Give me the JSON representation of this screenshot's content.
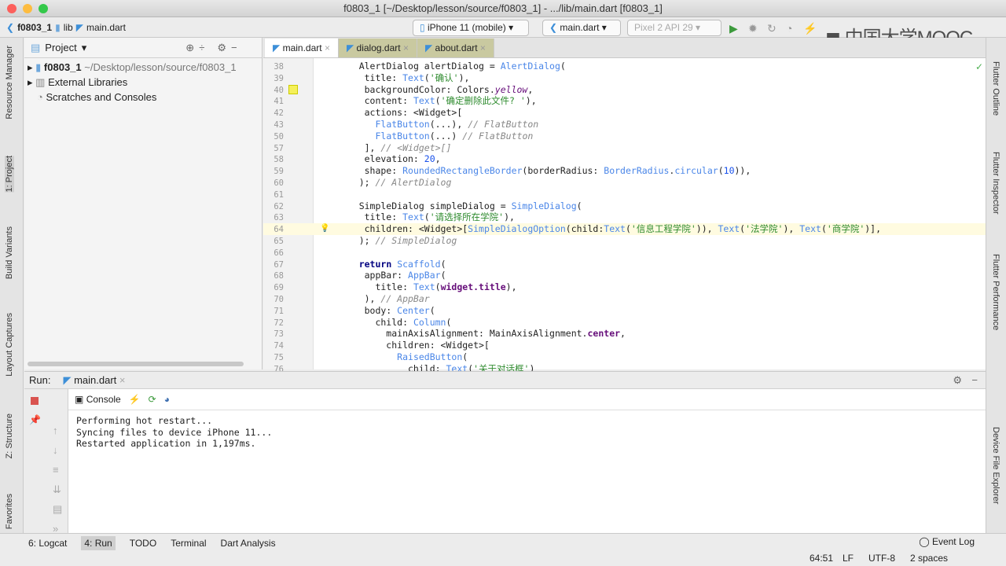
{
  "window": {
    "title": "f0803_1 [~/Desktop/lesson/source/f0803_1] - .../lib/main.dart [f0803_1]"
  },
  "nav": {
    "crumbs": [
      "f0803_1",
      "lib",
      "main.dart"
    ],
    "device": "iPhone 11 (mobile)",
    "config": "main.dart",
    "emulator": "Pixel 2 API 29",
    "watermark": "中国大学MOOC"
  },
  "left_tabs": [
    "Resource Manager",
    "1: Project",
    "Build Variants",
    "Layout Captures",
    "Z: Structure",
    "Favorites"
  ],
  "right_tabs": [
    "Flutter Outline",
    "Flutter Inspector",
    "Flutter Performance",
    "Device File Explorer"
  ],
  "project": {
    "header": "Project",
    "items": [
      {
        "name": "f0803_1",
        "path": "~/Desktop/lesson/source/f0803_1"
      },
      {
        "name": "External Libraries"
      },
      {
        "name": "Scratches and Consoles"
      }
    ]
  },
  "editor": {
    "tabs": [
      "main.dart",
      "dialog.dart",
      "about.dart"
    ],
    "lines": [
      {
        "n": "38",
        "t": [
          [
            "    ",
            ""
          ],
          [
            "AlertDialog alertDialog = ",
            ""
          ],
          [
            "AlertDialog",
            "cl"
          ],
          [
            "(",
            ""
          ]
        ]
      },
      {
        "n": "39",
        "t": [
          [
            "     title: ",
            ""
          ],
          [
            "Text",
            "cl"
          ],
          [
            "(",
            ""
          ],
          [
            "'确认'",
            "st"
          ],
          [
            "),",
            ""
          ]
        ]
      },
      {
        "n": "40",
        "t": [
          [
            "     backgroundColor: Colors.",
            ""
          ],
          [
            "yellow",
            "it"
          ],
          [
            ",",
            ""
          ]
        ]
      },
      {
        "n": "41",
        "t": [
          [
            "     content: ",
            ""
          ],
          [
            "Text",
            "cl"
          ],
          [
            "(",
            ""
          ],
          [
            "'确定删除此文件? '",
            "st"
          ],
          [
            "),",
            ""
          ]
        ]
      },
      {
        "n": "42",
        "t": [
          [
            "     actions: <Widget>[",
            ""
          ]
        ]
      },
      {
        "n": "43",
        "t": [
          [
            "       ",
            ""
          ],
          [
            "FlatButton",
            "cl"
          ],
          [
            "(...)",
            ""
          ],
          [
            ", ",
            ""
          ],
          [
            "// FlatButton",
            "cm"
          ]
        ]
      },
      {
        "n": "50",
        "t": [
          [
            "       ",
            ""
          ],
          [
            "FlatButton",
            "cl"
          ],
          [
            "(...)",
            ""
          ],
          [
            " ",
            ""
          ],
          [
            "// FlatButton",
            "cm"
          ]
        ]
      },
      {
        "n": "57",
        "t": [
          [
            "     ], ",
            ""
          ],
          [
            "// <Widget>[]",
            "cm"
          ]
        ]
      },
      {
        "n": "58",
        "t": [
          [
            "     elevation: ",
            ""
          ],
          [
            "20",
            "nu"
          ],
          [
            ",",
            ""
          ]
        ]
      },
      {
        "n": "59",
        "t": [
          [
            "     shape: ",
            ""
          ],
          [
            "RoundedRectangleBorder",
            "cl"
          ],
          [
            "(borderRadius: ",
            ""
          ],
          [
            "BorderRadius",
            "cl"
          ],
          [
            ".",
            ""
          ],
          [
            "circular",
            "cl"
          ],
          [
            "(",
            ""
          ],
          [
            "10",
            "nu"
          ],
          [
            ")),",
            ""
          ]
        ]
      },
      {
        "n": "60",
        "t": [
          [
            "    ); ",
            ""
          ],
          [
            "// AlertDialog",
            "cm"
          ]
        ]
      },
      {
        "n": "61",
        "t": []
      },
      {
        "n": "62",
        "t": [
          [
            "    SimpleDialog simpleDialog = ",
            ""
          ],
          [
            "SimpleDialog",
            "cl"
          ],
          [
            "(",
            ""
          ]
        ]
      },
      {
        "n": "63",
        "t": [
          [
            "     title: ",
            ""
          ],
          [
            "Text",
            "cl"
          ],
          [
            "(",
            ""
          ],
          [
            "'请选择所在学院'",
            "st"
          ],
          [
            "),",
            ""
          ]
        ]
      },
      {
        "n": "64",
        "t": [
          [
            "     children: <Widget>[",
            ""
          ],
          [
            "SimpleDialogOption",
            "cl"
          ],
          [
            "(child:",
            ""
          ],
          [
            "Text",
            "cl"
          ],
          [
            "(",
            ""
          ],
          [
            "'信息工程学院'",
            "st"
          ],
          [
            ")), ",
            ""
          ],
          [
            "Text",
            "cl"
          ],
          [
            "(",
            ""
          ],
          [
            "'法学院'",
            "st"
          ],
          [
            "), ",
            ""
          ],
          [
            "Text",
            "cl"
          ],
          [
            "(",
            ""
          ],
          [
            "'商学院'",
            "st"
          ],
          [
            ")],",
            ""
          ]
        ]
      },
      {
        "n": "65",
        "t": [
          [
            "    ); ",
            ""
          ],
          [
            "// SimpleDialog",
            "cm"
          ]
        ]
      },
      {
        "n": "66",
        "t": []
      },
      {
        "n": "67",
        "t": [
          [
            "    ",
            ""
          ],
          [
            "return",
            "kw"
          ],
          [
            " ",
            ""
          ],
          [
            "Scaffold",
            "cl"
          ],
          [
            "(",
            ""
          ]
        ]
      },
      {
        "n": "68",
        "t": [
          [
            "     appBar: ",
            ""
          ],
          [
            "AppBar",
            "cl"
          ],
          [
            "(",
            ""
          ]
        ]
      },
      {
        "n": "69",
        "t": [
          [
            "       title: ",
            ""
          ],
          [
            "Text",
            "cl"
          ],
          [
            "(",
            ""
          ],
          [
            "widget.title",
            "pu"
          ],
          [
            "),",
            ""
          ]
        ]
      },
      {
        "n": "70",
        "t": [
          [
            "     ), ",
            ""
          ],
          [
            "// AppBar",
            "cm"
          ]
        ]
      },
      {
        "n": "71",
        "t": [
          [
            "     body: ",
            ""
          ],
          [
            "Center",
            "cl"
          ],
          [
            "(",
            ""
          ]
        ]
      },
      {
        "n": "72",
        "t": [
          [
            "       child: ",
            ""
          ],
          [
            "Column",
            "cl"
          ],
          [
            "(",
            ""
          ]
        ]
      },
      {
        "n": "73",
        "t": [
          [
            "         mainAxisAlignment: MainAxisAlignment.",
            ""
          ],
          [
            "center",
            "pu"
          ],
          [
            ",",
            ""
          ]
        ]
      },
      {
        "n": "74",
        "t": [
          [
            "         children: <Widget>[",
            ""
          ]
        ]
      },
      {
        "n": "75",
        "t": [
          [
            "           ",
            ""
          ],
          [
            "RaisedButton",
            "cl"
          ],
          [
            "(",
            ""
          ]
        ]
      },
      {
        "n": "76",
        "t": [
          [
            "             child: ",
            ""
          ],
          [
            "Text",
            "cl"
          ],
          [
            "(",
            ""
          ],
          [
            "'关于对话框'",
            "st"
          ],
          [
            ")",
            ""
          ]
        ]
      }
    ]
  },
  "run": {
    "label": "Run:",
    "config": "main.dart",
    "console_tab": "Console",
    "output": [
      "Performing hot restart...",
      "Syncing files to device iPhone 11...",
      "Restarted application in 1,197ms."
    ]
  },
  "bottom_tabs": [
    "6: Logcat",
    "4: Run",
    "TODO",
    "Terminal",
    "Dart Analysis"
  ],
  "status": {
    "event_log": "Event Log",
    "position": "64:51",
    "line_sep": "LF",
    "encoding": "UTF-8",
    "indent": "2 spaces"
  }
}
